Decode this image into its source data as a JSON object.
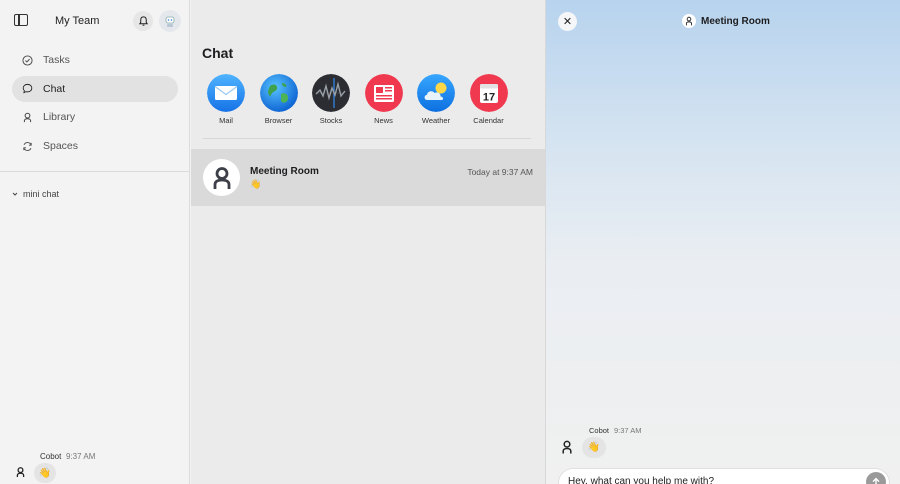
{
  "sidebar": {
    "team_name": "My Team",
    "nav": [
      {
        "label": "Tasks",
        "icon": "check-circle-icon"
      },
      {
        "label": "Chat",
        "icon": "chat-bubble-icon",
        "active": true
      },
      {
        "label": "Library",
        "icon": "person-icon"
      },
      {
        "label": "Spaces",
        "icon": "refresh-icon"
      }
    ],
    "mini_chat_label": "mini chat",
    "mini_message": {
      "sender": "Cobot",
      "time": "9:37 AM",
      "content": "👋"
    }
  },
  "middle": {
    "title": "Chat",
    "apps": [
      {
        "label": "Mail",
        "icon": "mail-icon"
      },
      {
        "label": "Browser",
        "icon": "globe-icon"
      },
      {
        "label": "Stocks",
        "icon": "stocks-icon"
      },
      {
        "label": "News",
        "icon": "news-icon"
      },
      {
        "label": "Weather",
        "icon": "weather-icon"
      },
      {
        "label": "Calendar",
        "icon": "calendar-icon",
        "day": "17"
      }
    ],
    "conversation": {
      "name": "Meeting Room",
      "time": "Today at 9:37 AM",
      "preview": "👋"
    }
  },
  "right": {
    "close_glyph": "✕",
    "room_title": "Meeting Room",
    "message": {
      "sender": "Cobot",
      "time": "9:37 AM",
      "content": "👋"
    },
    "composer_value": "Hey, what can you help me with?"
  },
  "colors": {
    "accent_blue": "#1f8ef1",
    "news_red": "#f0394f",
    "panel_gradient_top": "#b7d3ee"
  }
}
